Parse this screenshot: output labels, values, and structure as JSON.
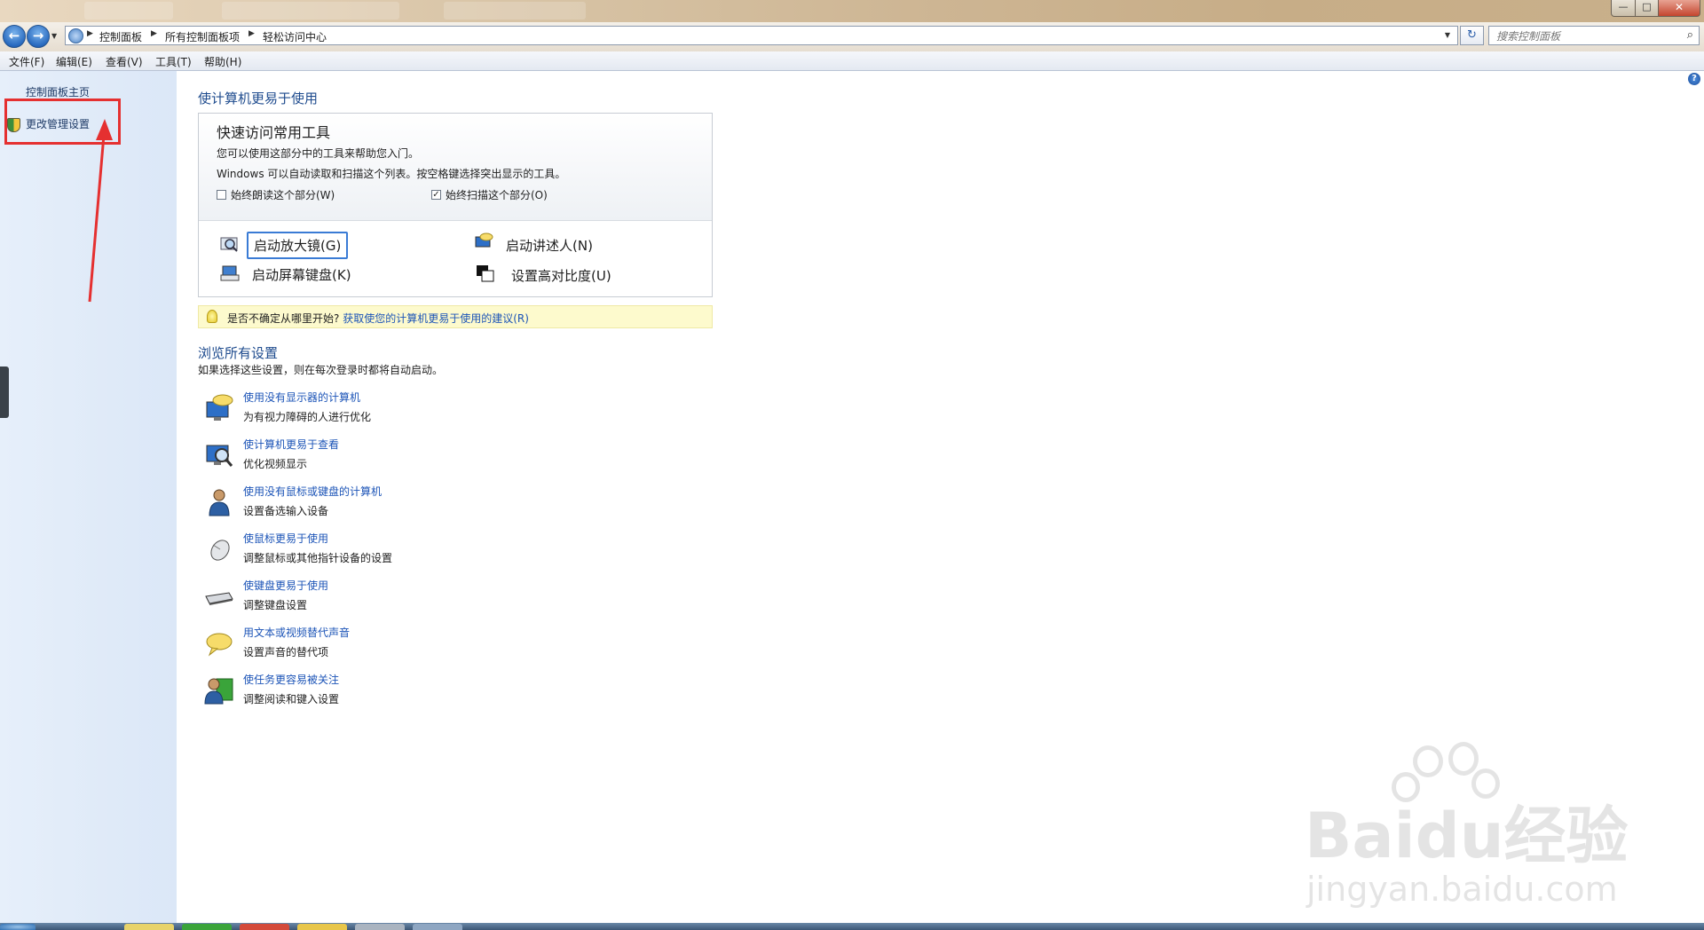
{
  "window": {
    "close_glyph": "✕",
    "max_glyph": "□",
    "min_glyph": "—"
  },
  "nav": {
    "back_glyph": "←",
    "forward_glyph": "→",
    "dropdown_glyph": "▼"
  },
  "address": {
    "crumbs": [
      "控制面板",
      "所有控制面板项",
      "轻松访问中心"
    ],
    "separator": "▶",
    "refresh_glyph": "↻"
  },
  "search": {
    "placeholder": "搜索控制面板",
    "icon_glyph": "⌕"
  },
  "menu": [
    "文件(F)",
    "编辑(E)",
    "查看(V)",
    "工具(T)",
    "帮助(H)"
  ],
  "sidebar": {
    "items": [
      {
        "label": "控制面板主页"
      },
      {
        "label": "更改管理设置"
      }
    ]
  },
  "help_glyph": "?",
  "main": {
    "heading": "使计算机更易于使用",
    "quick": {
      "title": "快速访问常用工具",
      "line1": "您可以使用这部分中的工具来帮助您入门。",
      "line2": "Windows 可以自动读取和扫描这个列表。按空格键选择突出显示的工具。",
      "chk1": {
        "label": "始终朗读这个部分(W)",
        "checked": false,
        "mark": ""
      },
      "chk2": {
        "label": "始终扫描这个部分(O)",
        "checked": true,
        "mark": "✓"
      },
      "tools": [
        "启动放大镜(G)",
        "启动讲述人(N)",
        "启动屏幕键盘(K)",
        "设置高对比度(U)"
      ]
    },
    "tip": {
      "question": "是否不确定从哪里开始?",
      "link": "获取使您的计算机更易于使用的建议(R)"
    },
    "browse": {
      "heading": "浏览所有设置",
      "sub": "如果选择这些设置，则在每次登录时都将自动启动。",
      "items": [
        {
          "title": "使用没有显示器的计算机",
          "desc": "为有视力障碍的人进行优化",
          "icon": "monitor-speech-icon"
        },
        {
          "title": "使计算机更易于查看",
          "desc": "优化视频显示",
          "icon": "monitor-magnifier-icon"
        },
        {
          "title": "使用没有鼠标或键盘的计算机",
          "desc": "设置备选输入设备",
          "icon": "person-icon"
        },
        {
          "title": "使鼠标更易于使用",
          "desc": "调整鼠标或其他指针设备的设置",
          "icon": "mouse-icon"
        },
        {
          "title": "使键盘更易于使用",
          "desc": "调整键盘设置",
          "icon": "keyboard-icon"
        },
        {
          "title": "用文本或视频替代声音",
          "desc": "设置声音的替代项",
          "icon": "speech-bubble-icon"
        },
        {
          "title": "使任务更容易被关注",
          "desc": "调整阅读和键入设置",
          "icon": "person-screen-icon"
        }
      ]
    }
  },
  "watermark": {
    "logo_text": "Baidu经验",
    "url": "jingyan.baidu.com"
  },
  "colors": {
    "link": "#1c54b7",
    "heading": "#1e4b8e",
    "highlight_box": "#e53030",
    "tip_bg": "#fdfacd"
  }
}
